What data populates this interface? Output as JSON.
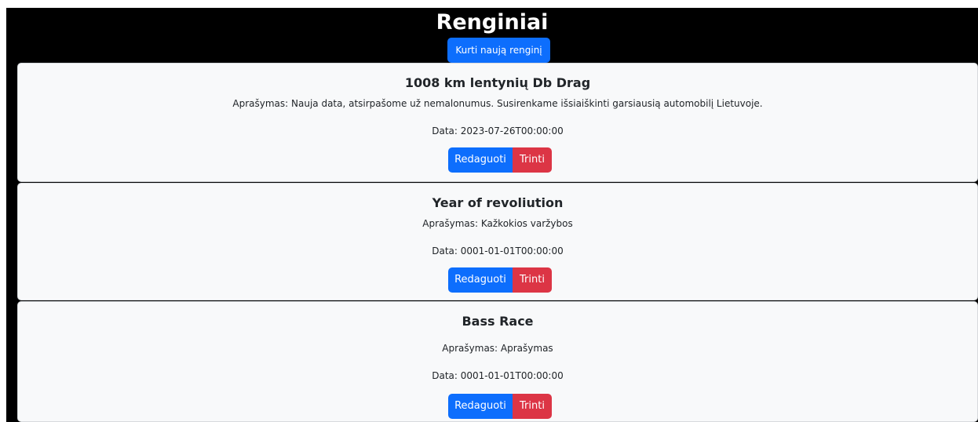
{
  "header": {
    "title": "Renginiai",
    "create_label": "Kurti naują renginį"
  },
  "events": [
    {
      "title": "1008 km lentynių Db Drag",
      "description": "Aprašymas: Nauja data, atsirpašome už nemalonumus. Susirenkame išsiaiškinti garsiausią automobilį Lietuvoje.",
      "date": "Data: 2023-07-26T00:00:00",
      "edit_label": "Redaguoti",
      "delete_label": "Trinti"
    },
    {
      "title": "Year of revoliution",
      "description": "Aprašymas: Kažkokios varžybos",
      "date": "Data: 0001-01-01T00:00:00",
      "edit_label": "Redaguoti",
      "delete_label": "Trinti"
    },
    {
      "title": "Bass Race",
      "description": "Aprašymas: Aprašymas",
      "date": "Data: 0001-01-01T00:00:00",
      "edit_label": "Redaguoti",
      "delete_label": "Trinti"
    }
  ],
  "colors": {
    "page_background": "#000000",
    "card_background": "#f8f9fa",
    "primary_button": "#0d6efd",
    "danger_button": "#dc3545"
  }
}
